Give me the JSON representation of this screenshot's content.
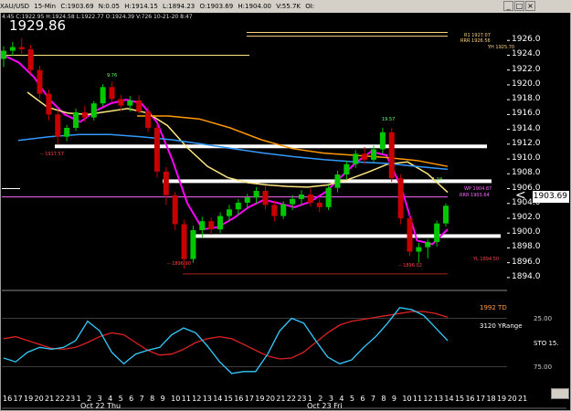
{
  "header": {
    "symbol": "XAU/USD",
    "timeframe": "15-Min",
    "close": "C:1903.69",
    "net": "N:0.05",
    "high": "H:1914.15",
    "low": "L:1894.23",
    "open": "O:1903.69",
    "hi2": "H:1904.00",
    "volume": "V:55.7K",
    "oi": "OI:",
    "subline": "4:45  C:1922.95  H:1924.58  L:1922.77  O:1924.39  V:726  10-21-20  8:47"
  },
  "price_display": "1929.86",
  "last_price": "1903.69",
  "colors": {
    "background": "#000000",
    "up_candle": "#00c800",
    "down_candle": "#c80000",
    "ma_fast": "#ff00ff",
    "ma_slow": "#ffe680",
    "ma_long": "#3399ff",
    "ma_orange": "#ff9900",
    "sr_line": "#ffffff",
    "sto_k": "#33ccff",
    "sto_d": "#dd2222",
    "level_line": "#ffd27f"
  },
  "pivot_labels": {
    "r1": "R1  1927.07",
    "r2": "RRR  1926.56",
    "yh": "YH 1925.70",
    "wp": "WP 1904.87",
    "rr": "RRR 1903.64",
    "yl": "YL 1894.50",
    "l1": "-- 1917.57",
    "h1": "19.57",
    "h2": "9.76",
    "l2": "-- 1896.90",
    "l3": "-- 1896.02",
    "h3": "1.19"
  },
  "indicator": {
    "name": "STO",
    "value_label": "STO  15.",
    "td_label": "1992 TD",
    "range_label": "3120 YRange",
    "ticks": [
      "25.00",
      "75.00"
    ]
  },
  "chart_data": {
    "type": "candlestick",
    "title": "",
    "ylim": [
      1893,
      1928
    ],
    "yticks": [
      1926,
      1924,
      1922,
      1920,
      1918,
      1916,
      1914,
      1912,
      1910,
      1908,
      1906,
      1904,
      1902,
      1900,
      1898,
      1896,
      1894
    ],
    "xticks": [
      "16",
      "17",
      "19",
      "20",
      "21",
      "22",
      "23",
      "1",
      "2",
      "3",
      "4",
      "5",
      "6",
      "7",
      "8",
      "9",
      "10",
      "11",
      "12",
      "13",
      "14",
      "15",
      "16",
      "17",
      "19",
      "20",
      "21",
      "22",
      "23",
      "1",
      "2",
      "3",
      "4",
      "5",
      "6",
      "7",
      "8",
      "9",
      "10",
      "11",
      "12",
      "13",
      "14",
      "15",
      "16",
      "17",
      "18",
      "19",
      "20",
      "21"
    ],
    "date_labels": [
      "Oct 22 Thu",
      "Oct 23 Fri"
    ],
    "support_resistance": [
      1911.7,
      1907.0,
      1899.6
    ],
    "horizontal_levels": [
      1927.07,
      1926.56,
      1924.0,
      1906.0,
      1904.87
    ],
    "candles": [
      [
        1923.5,
        1925.2,
        1922.4,
        1924.6
      ],
      [
        1924.6,
        1925.8,
        1923.9,
        1925.1
      ],
      [
        1925.1,
        1926.3,
        1924.2,
        1924.8
      ],
      [
        1924.8,
        1925.4,
        1921.5,
        1922.0
      ],
      [
        1922.0,
        1922.6,
        1918.2,
        1918.8
      ],
      [
        1918.8,
        1919.4,
        1915.2,
        1916.0
      ],
      [
        1916.0,
        1916.6,
        1912.0,
        1913.0
      ],
      [
        1913.0,
        1914.6,
        1912.4,
        1914.2
      ],
      [
        1914.2,
        1916.8,
        1913.8,
        1916.3
      ],
      [
        1916.3,
        1917.2,
        1915.0,
        1915.6
      ],
      [
        1915.6,
        1917.8,
        1915.2,
        1917.5
      ],
      [
        1917.5,
        1920.1,
        1917.1,
        1919.7
      ],
      [
        1919.7,
        1920.4,
        1917.6,
        1918.1
      ],
      [
        1918.1,
        1918.7,
        1916.5,
        1917.2
      ],
      [
        1917.2,
        1918.5,
        1916.4,
        1917.9
      ],
      [
        1917.9,
        1918.6,
        1916.1,
        1916.4
      ],
      [
        1916.4,
        1917.0,
        1913.6,
        1914.2
      ],
      [
        1914.2,
        1914.8,
        1907.5,
        1908.3
      ],
      [
        1908.3,
        1908.9,
        1903.8,
        1905.1
      ],
      [
        1905.1,
        1905.6,
        1900.4,
        1901.2
      ],
      [
        1901.2,
        1901.8,
        1895.2,
        1896.5
      ],
      [
        1896.5,
        1901.0,
        1896.0,
        1900.4
      ],
      [
        1900.4,
        1902.2,
        1899.4,
        1901.6
      ],
      [
        1901.6,
        1902.1,
        1899.8,
        1900.5
      ],
      [
        1900.5,
        1902.8,
        1900.0,
        1902.3
      ],
      [
        1902.3,
        1903.8,
        1901.6,
        1903.2
      ],
      [
        1903.2,
        1904.6,
        1902.4,
        1904.1
      ],
      [
        1904.1,
        1905.3,
        1903.3,
        1904.8
      ],
      [
        1904.8,
        1906.2,
        1904.0,
        1905.7
      ],
      [
        1905.7,
        1906.4,
        1903.2,
        1903.8
      ],
      [
        1903.8,
        1904.4,
        1901.6,
        1902.3
      ],
      [
        1902.3,
        1904.3,
        1901.9,
        1903.9
      ],
      [
        1903.9,
        1905.1,
        1903.1,
        1904.6
      ],
      [
        1904.6,
        1905.8,
        1903.7,
        1905.2
      ],
      [
        1905.2,
        1906.0,
        1903.6,
        1904.1
      ],
      [
        1904.1,
        1904.7,
        1902.8,
        1903.5
      ],
      [
        1903.5,
        1906.5,
        1903.1,
        1906.1
      ],
      [
        1906.1,
        1908.4,
        1905.5,
        1907.9
      ],
      [
        1907.9,
        1909.8,
        1907.3,
        1909.3
      ],
      [
        1909.3,
        1911.2,
        1908.8,
        1910.7
      ],
      [
        1910.7,
        1911.6,
        1909.3,
        1909.9
      ],
      [
        1909.9,
        1911.8,
        1909.5,
        1911.3
      ],
      [
        1911.3,
        1914.2,
        1910.7,
        1913.6
      ],
      [
        1913.6,
        1914.2,
        1906.9,
        1907.4
      ],
      [
        1907.4,
        1907.9,
        1901.2,
        1902.0
      ],
      [
        1902.0,
        1902.6,
        1896.9,
        1897.5
      ],
      [
        1897.5,
        1898.7,
        1896.0,
        1898.1
      ],
      [
        1898.1,
        1899.2,
        1896.6,
        1898.8
      ],
      [
        1898.8,
        1901.7,
        1898.2,
        1901.3
      ],
      [
        1901.3,
        1904.0,
        1900.9,
        1903.69
      ]
    ],
    "series": [
      {
        "name": "",
        "values": [
          1924.0,
          1923.0,
          1921.0,
          1918.0,
          1916.0,
          1915.0,
          1916.5,
          1917.5,
          1918.0,
          1917.5,
          1915.0,
          1910.0,
          1904.0,
          1900.5,
          1900.8,
          1902.0,
          1903.5,
          1904.5,
          1904.0,
          1903.5,
          1904.2,
          1905.5,
          1907.5,
          1909.5,
          1911.0,
          1910.5,
          1906.0,
          1899.0,
          1898.5,
          1900.5
        ]
      },
      {
        "name": "",
        "values": [
          1919.0,
          1917.0,
          1916.2,
          1916.0,
          1916.4,
          1916.8,
          1916.2,
          1914.5,
          1911.5,
          1909.0,
          1907.5,
          1906.8,
          1906.5,
          1906.3,
          1906.2,
          1906.5,
          1907.2,
          1908.2,
          1909.3,
          1909.6,
          1908.0,
          1905.5
        ]
      },
      {
        "name": "",
        "values": [
          1912.5,
          1913.0,
          1913.3,
          1913.3,
          1913.0,
          1912.6,
          1912.0,
          1911.4,
          1910.8,
          1910.3,
          1909.9,
          1909.6,
          1909.4,
          1909.0,
          1908.6
        ]
      },
      {
        "name": "",
        "values": [
          1915.8,
          1915.8,
          1915.4,
          1914.2,
          1912.6,
          1911.4,
          1910.8,
          1910.5,
          1910.2,
          1909.8,
          1909.0
        ]
      }
    ],
    "sto_k": [
      66,
      70,
      60,
      55,
      57,
      55,
      48,
      28,
      38,
      60,
      72,
      62,
      58,
      55,
      42,
      35,
      40,
      54,
      70,
      82,
      80,
      80,
      62,
      38,
      25,
      30,
      48,
      65,
      72,
      68,
      55,
      44,
      30,
      14,
      16,
      22,
      35,
      48
    ],
    "sto_d": [
      46,
      44,
      48,
      52,
      56,
      57,
      55,
      50,
      44,
      40,
      42,
      50,
      58,
      63,
      62,
      57,
      50,
      46,
      44,
      46,
      52,
      58,
      64,
      67,
      66,
      60,
      50,
      40,
      32,
      28,
      26,
      24,
      22,
      20,
      18,
      18,
      20,
      24
    ],
    "sto_ylim": [
      0,
      100
    ]
  }
}
